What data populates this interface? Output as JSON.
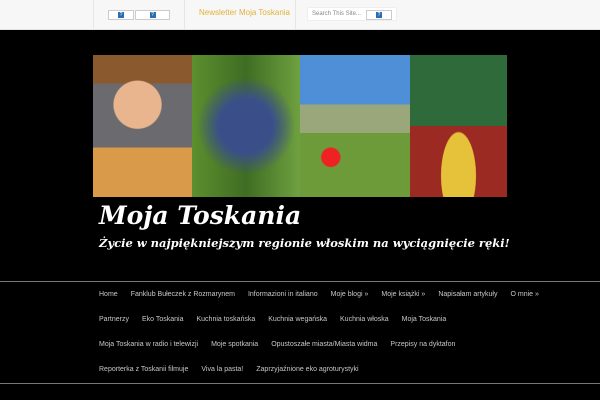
{
  "topbar": {
    "social_buttons": [
      "?",
      "?"
    ],
    "newsletter": "Newsletter Moja Toskania",
    "search_placeholder": "Search This Site...",
    "search_button": "?"
  },
  "header": {
    "title": "Moja Toskania",
    "tagline": "Życie w najpiękniejszym regionie włoskim na wyciągnięcie ręki!"
  },
  "menu": [
    [
      "Home",
      "Fanklub Bułeczek z Rozmarynem",
      "Informazioni in italiano",
      "Moje blogi »",
      "Moje książki »",
      "Napisałam artykuły",
      "O mnie »"
    ],
    [
      "Partnerzy",
      "Eko Toskania",
      "Kuchnia toskańska",
      "Kuchnia wegańska",
      "Kuchnia włoska",
      "Moja Toskania"
    ],
    [
      "Moja Toskania w radio i telewizji",
      "Moje spotkania",
      "Opustoszałe miasta/Miasta widma",
      "Przepisy na dyktafon"
    ],
    [
      "Reporterka z Toskanii filmuje",
      "Viva la pasta!",
      "Zaprzyjaźnione eko agroturystyki"
    ]
  ]
}
